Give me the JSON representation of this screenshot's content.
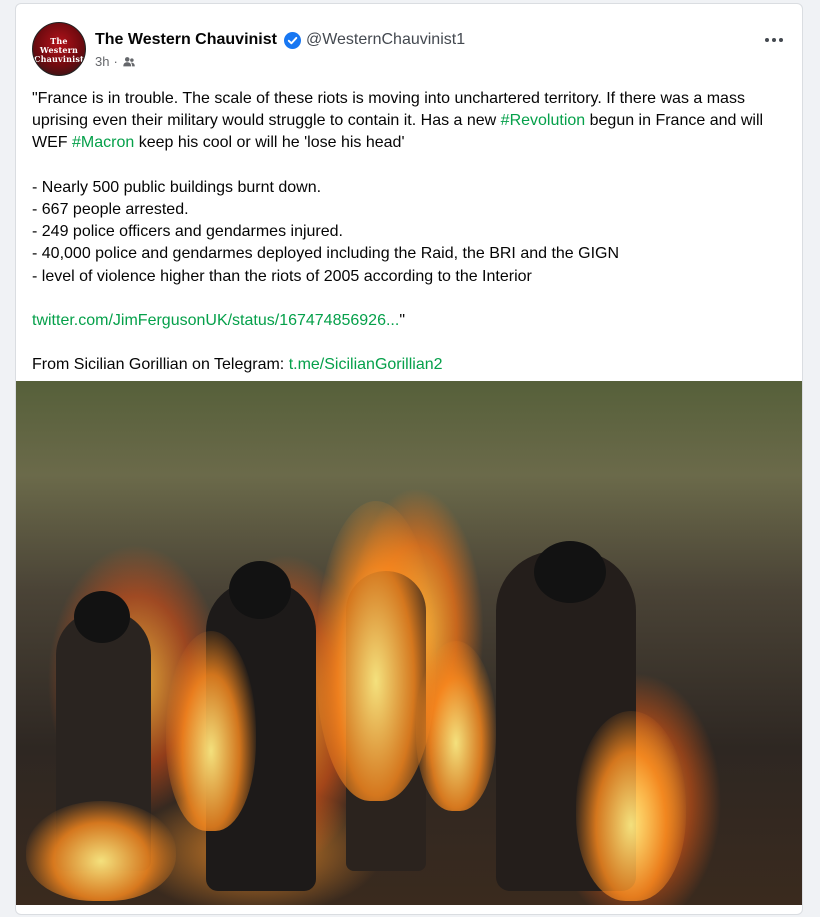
{
  "post": {
    "author": "The Western Chauvinist",
    "handle": "@WesternChauvinist1",
    "avatar_text": "The Western Chauvinist",
    "time": "3h",
    "meta_separator": "·",
    "icons": {
      "verified": "verified-badge-icon",
      "audience": "friends-audience-icon",
      "more": "more-options-icon"
    },
    "colors": {
      "link": "#05a04a",
      "verified": "#1877f2",
      "text": "#050505",
      "meta": "#65676b"
    },
    "body": {
      "line1_pre": "\"France is in trouble. The scale of these riots is moving into unchartered territory. If there was a mass uprising even their military would struggle to contain it. Has a new ",
      "hashtag_revolution": "#Revolution",
      "line1_mid": " begun in France and will WEF ",
      "hashtag_macron": "#Macron",
      "line1_post": " keep his cool or will he 'lose his head'",
      "bullets": [
        "- Nearly 500 public buildings burnt down.",
        "- 667 people arrested.",
        "- 249 police officers and gendarmes injured.",
        "- 40,000 police and gendarmes deployed including the Raid, the BRI and the GIGN",
        "- level of violence higher than the riots of 2005 according to the Interior"
      ],
      "twitter_link": "twitter.com/JimFergusonUK/status/167474856926...",
      "twitter_suffix": "\"",
      "source_prefix": "From Sicilian Gorillian on Telegram: ",
      "telegram_link": "t.me/SicilianGorillian2"
    }
  }
}
